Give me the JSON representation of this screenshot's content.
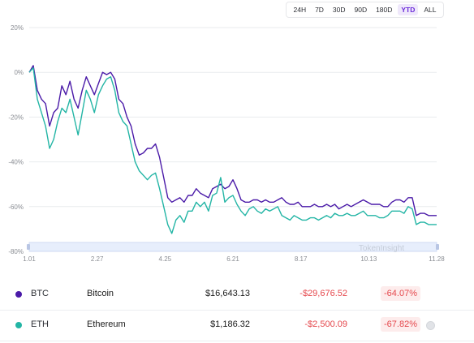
{
  "range_tabs": {
    "items": [
      "24H",
      "7D",
      "30D",
      "90D",
      "180D",
      "YTD",
      "ALL"
    ],
    "active": "YTD"
  },
  "chart_data": {
    "type": "line",
    "ylim": [
      -80,
      20
    ],
    "yticks": [
      "20%",
      "0%",
      "-20%",
      "-40%",
      "-60%",
      "-80%"
    ],
    "ytick_values": [
      20,
      0,
      -20,
      -40,
      -60,
      -80
    ],
    "xticks": [
      "1.01",
      "2.27",
      "4.25",
      "6.21",
      "8.17",
      "10.13",
      "11.28"
    ],
    "grid": true,
    "watermark": "TokenInsight",
    "colors": {
      "BTC": "#4a1aa8",
      "ETH": "#23b5a5"
    },
    "series": [
      {
        "name": "BTC",
        "x": [
          0,
          1,
          2,
          3,
          4,
          5,
          6,
          7,
          8,
          9,
          10,
          11,
          12,
          13,
          14,
          15,
          16,
          17,
          18,
          19,
          20,
          21,
          22,
          23,
          24,
          25,
          26,
          27,
          28,
          29,
          30,
          31,
          32,
          33,
          34,
          35,
          36,
          37,
          38,
          39,
          40,
          41,
          42,
          43,
          44,
          45,
          46,
          47,
          48,
          49,
          50,
          51,
          52,
          53,
          54,
          55,
          56,
          57,
          58,
          59,
          60,
          61,
          62,
          63,
          64,
          65,
          66,
          67,
          68,
          69,
          70,
          71,
          72,
          73,
          74,
          75,
          76,
          77,
          78,
          79,
          80,
          81,
          82,
          83,
          84,
          85,
          86,
          87,
          88,
          89,
          90,
          91,
          92,
          93,
          94,
          95,
          96,
          97,
          98,
          99,
          100
        ],
        "values": [
          0,
          3,
          -8,
          -12,
          -14,
          -24,
          -18,
          -16,
          -6,
          -10,
          -4,
          -12,
          -16,
          -8,
          -2,
          -6,
          -10,
          -5,
          0,
          -1,
          0,
          -3,
          -12,
          -14,
          -20,
          -24,
          -32,
          -37,
          -36,
          -34,
          -34,
          -32,
          -38,
          -47,
          -56,
          -58,
          -57,
          -56,
          -58,
          -55,
          -55,
          -52,
          -54,
          -55,
          -56,
          -52,
          -51,
          -50,
          -52,
          -51,
          -48,
          -52,
          -57,
          -58,
          -58,
          -57,
          -57,
          -58,
          -57,
          -58,
          -58,
          -57,
          -56,
          -58,
          -59,
          -59,
          -58,
          -60,
          -60,
          -60,
          -59,
          -60,
          -60,
          -59,
          -60,
          -59,
          -61,
          -60,
          -59,
          -60,
          -59,
          -58,
          -57,
          -58,
          -59,
          -59,
          -59,
          -60,
          -60,
          -58,
          -57,
          -57,
          -58,
          -56,
          -56,
          -64,
          -63,
          -63,
          -64,
          -64,
          -64
        ]
      },
      {
        "name": "ETH",
        "x": [
          0,
          1,
          2,
          3,
          4,
          5,
          6,
          7,
          8,
          9,
          10,
          11,
          12,
          13,
          14,
          15,
          16,
          17,
          18,
          19,
          20,
          21,
          22,
          23,
          24,
          25,
          26,
          27,
          28,
          29,
          30,
          31,
          32,
          33,
          34,
          35,
          36,
          37,
          38,
          39,
          40,
          41,
          42,
          43,
          44,
          45,
          46,
          47,
          48,
          49,
          50,
          51,
          52,
          53,
          54,
          55,
          56,
          57,
          58,
          59,
          60,
          61,
          62,
          63,
          64,
          65,
          66,
          67,
          68,
          69,
          70,
          71,
          72,
          73,
          74,
          75,
          76,
          77,
          78,
          79,
          80,
          81,
          82,
          83,
          84,
          85,
          86,
          87,
          88,
          89,
          90,
          91,
          92,
          93,
          94,
          95,
          96,
          97,
          98,
          99,
          100
        ],
        "values": [
          0,
          2,
          -12,
          -18,
          -24,
          -34,
          -30,
          -22,
          -16,
          -18,
          -12,
          -20,
          -28,
          -18,
          -8,
          -12,
          -18,
          -10,
          -6,
          -3,
          -2,
          -8,
          -18,
          -22,
          -24,
          -32,
          -40,
          -44,
          -46,
          -48,
          -46,
          -45,
          -52,
          -60,
          -68,
          -72,
          -66,
          -64,
          -67,
          -62,
          -62,
          -58,
          -60,
          -58,
          -62,
          -55,
          -54,
          -47,
          -58,
          -56,
          -55,
          -59,
          -62,
          -64,
          -61,
          -60,
          -62,
          -63,
          -61,
          -62,
          -61,
          -60,
          -64,
          -65,
          -66,
          -64,
          -65,
          -66,
          -66,
          -65,
          -65,
          -66,
          -65,
          -64,
          -65,
          -63,
          -64,
          -64,
          -63,
          -64,
          -64,
          -63,
          -62,
          -64,
          -64,
          -64,
          -65,
          -65,
          -64,
          -62,
          -62,
          -62,
          -63,
          -60,
          -61,
          -68,
          -67,
          -67,
          -68,
          -68,
          -68
        ]
      }
    ]
  },
  "assets": [
    {
      "symbol": "BTC",
      "name": "Bitcoin",
      "price": "$16,643.13",
      "change": "-$29,676.52",
      "percent": "-64.07%",
      "color": "#4a1aa8"
    },
    {
      "symbol": "ETH",
      "name": "Ethereum",
      "price": "$1,186.32",
      "change": "-$2,500.09",
      "percent": "-67.82%",
      "color": "#23b5a5"
    }
  ]
}
